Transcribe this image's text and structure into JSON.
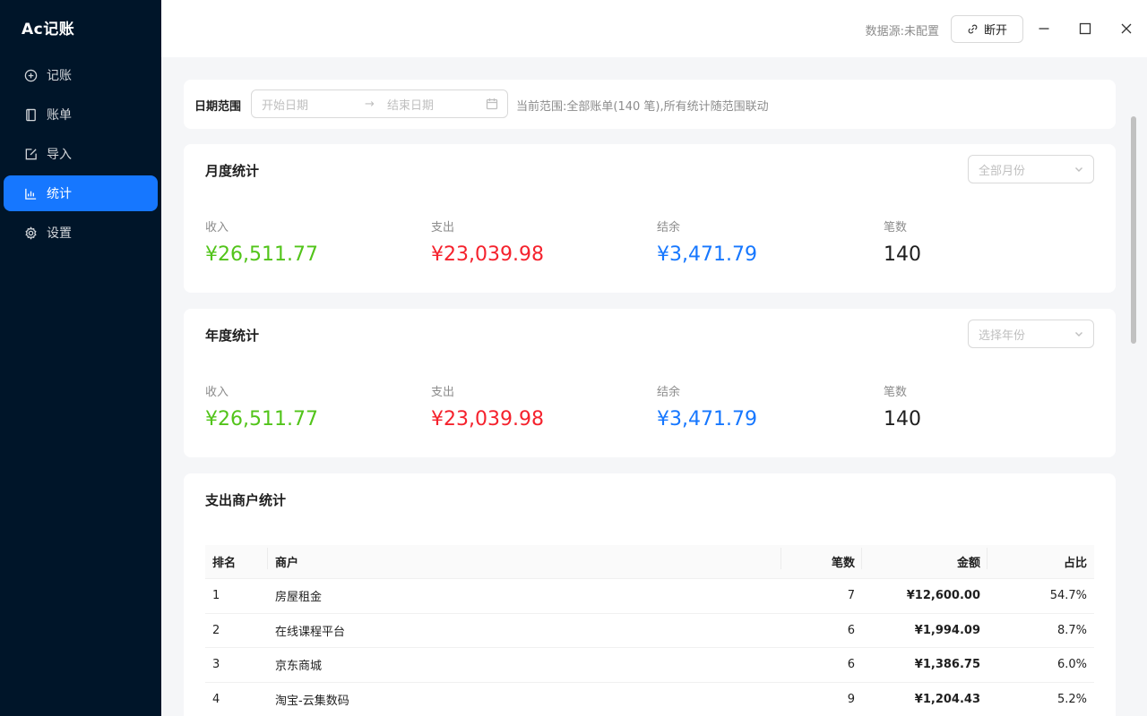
{
  "app": {
    "logo": "Ac记账"
  },
  "nav": {
    "items": [
      {
        "label": "记账",
        "icon": "plus-circle-icon"
      },
      {
        "label": "账单",
        "icon": "book-icon"
      },
      {
        "label": "导入",
        "icon": "import-icon"
      },
      {
        "label": "统计",
        "icon": "bar-chart-icon",
        "active": true
      },
      {
        "label": "设置",
        "icon": "gear-icon"
      }
    ]
  },
  "topbar": {
    "datasource_label": "数据源:",
    "datasource_value": "未配置",
    "disconnect_label": "断开"
  },
  "date_filter": {
    "label": "日期范围",
    "start_placeholder": "开始日期",
    "end_placeholder": "结束日期",
    "arrow": "→",
    "range_info": "当前范围:全部账单(140 笔),所有统计随范围联动"
  },
  "monthly": {
    "title": "月度统计",
    "select_placeholder": "全部月份",
    "income_label": "收入",
    "income_value": "¥26,511.77",
    "expense_label": "支出",
    "expense_value": "¥23,039.98",
    "balance_label": "结余",
    "balance_value": "¥3,471.79",
    "count_label": "笔数",
    "count_value": "140"
  },
  "yearly": {
    "title": "年度统计",
    "select_placeholder": "选择年份",
    "income_label": "收入",
    "income_value": "¥26,511.77",
    "expense_label": "支出",
    "expense_value": "¥23,039.98",
    "balance_label": "结余",
    "balance_value": "¥3,471.79",
    "count_label": "笔数",
    "count_value": "140"
  },
  "merchants": {
    "title": "支出商户统计",
    "columns": {
      "rank": "排名",
      "merchant": "商户",
      "count": "笔数",
      "amount": "金额",
      "share": "占比"
    },
    "rows": [
      {
        "rank": "1",
        "merchant": "房屋租金",
        "count": "7",
        "amount": "¥12,600.00",
        "share": "54.7%"
      },
      {
        "rank": "2",
        "merchant": "在线课程平台",
        "count": "6",
        "amount": "¥1,994.09",
        "share": "8.7%"
      },
      {
        "rank": "3",
        "merchant": "京东商城",
        "count": "6",
        "amount": "¥1,386.75",
        "share": "6.0%"
      },
      {
        "rank": "4",
        "merchant": "淘宝-云集数码",
        "count": "9",
        "amount": "¥1,204.43",
        "share": "5.2%"
      }
    ]
  },
  "colors": {
    "income": "#52c41a",
    "expense": "#f5222d",
    "balance": "#1677ff",
    "count": "#1f1f1f",
    "sidebar_bg": "#001529",
    "accent": "#1677ff"
  }
}
